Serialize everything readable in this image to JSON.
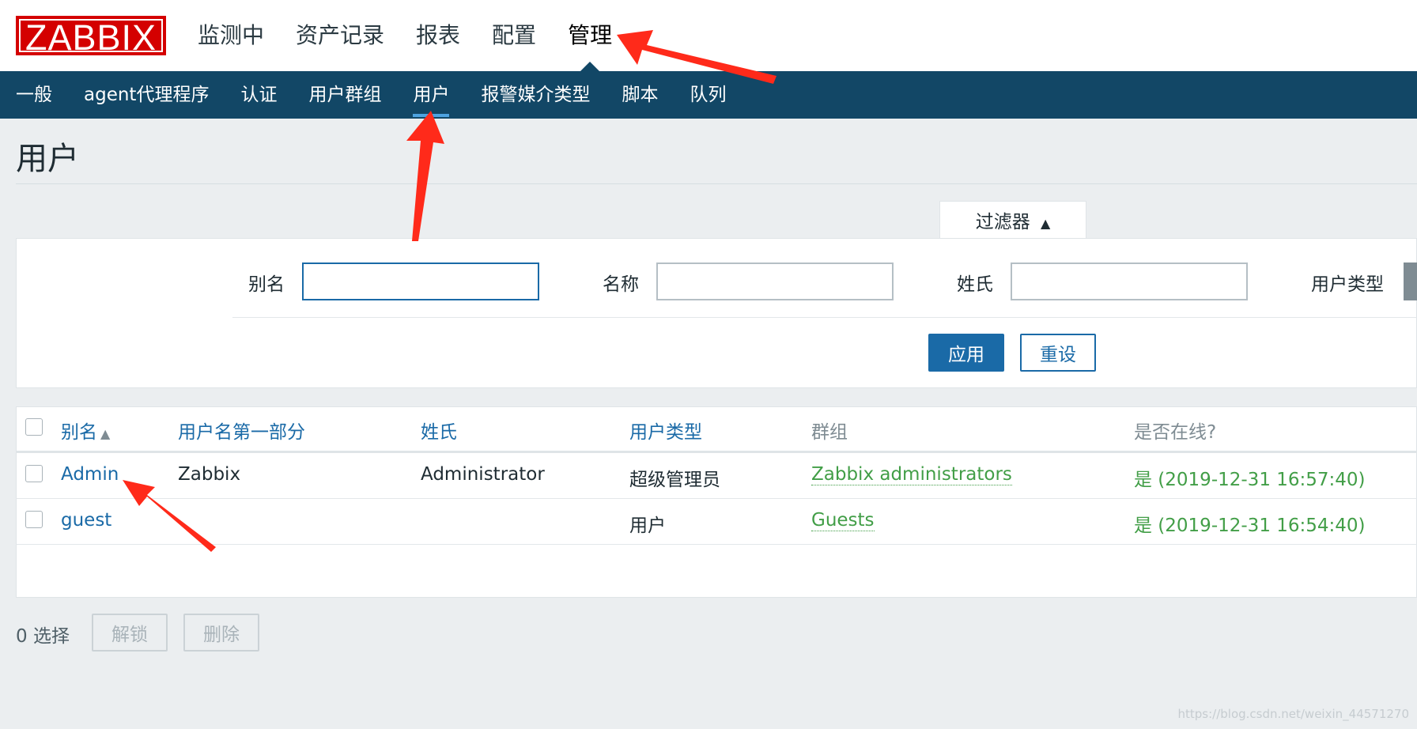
{
  "header": {
    "logo": "ZABBIX",
    "main_nav": [
      "监测中",
      "资产记录",
      "报表",
      "配置",
      "管理"
    ],
    "active_main": "管理"
  },
  "sub_nav": {
    "items": [
      "一般",
      "agent代理程序",
      "认证",
      "用户群组",
      "用户",
      "报警媒介类型",
      "脚本",
      "队列"
    ],
    "active": "用户"
  },
  "page": {
    "title": "用户"
  },
  "filter": {
    "tab_label": "过滤器",
    "tab_icon": "triangle-up-icon",
    "fields": {
      "alias_label": "别名",
      "alias_value": "",
      "name_label": "名称",
      "name_value": "",
      "surname_label": "姓氏",
      "surname_value": "",
      "type_label": "用户类型"
    },
    "apply_label": "应用",
    "reset_label": "重设"
  },
  "table": {
    "columns": [
      "别名",
      "用户名第一部分",
      "姓氏",
      "用户类型",
      "群组",
      "是否在线?"
    ],
    "rows": [
      {
        "alias": "Admin",
        "name": "Zabbix",
        "surname": "Administrator",
        "type": "超级管理员",
        "group": "Zabbix administrators",
        "online": "是 (2019-12-31 16:57:40)"
      },
      {
        "alias": "guest",
        "name": "",
        "surname": "",
        "type": "用户",
        "group": "Guests",
        "online": "是 (2019-12-31 16:54:40)"
      }
    ]
  },
  "footer": {
    "selected": "0 选择",
    "unlock_label": "解锁",
    "delete_label": "删除"
  },
  "watermark": "https://blog.csdn.net/weixin_44571270",
  "colors": {
    "brand": "#d40000",
    "nav_bg": "#124766",
    "link": "#1a6aa7",
    "online": "#429e47",
    "annotation": "#ff2a1a"
  }
}
